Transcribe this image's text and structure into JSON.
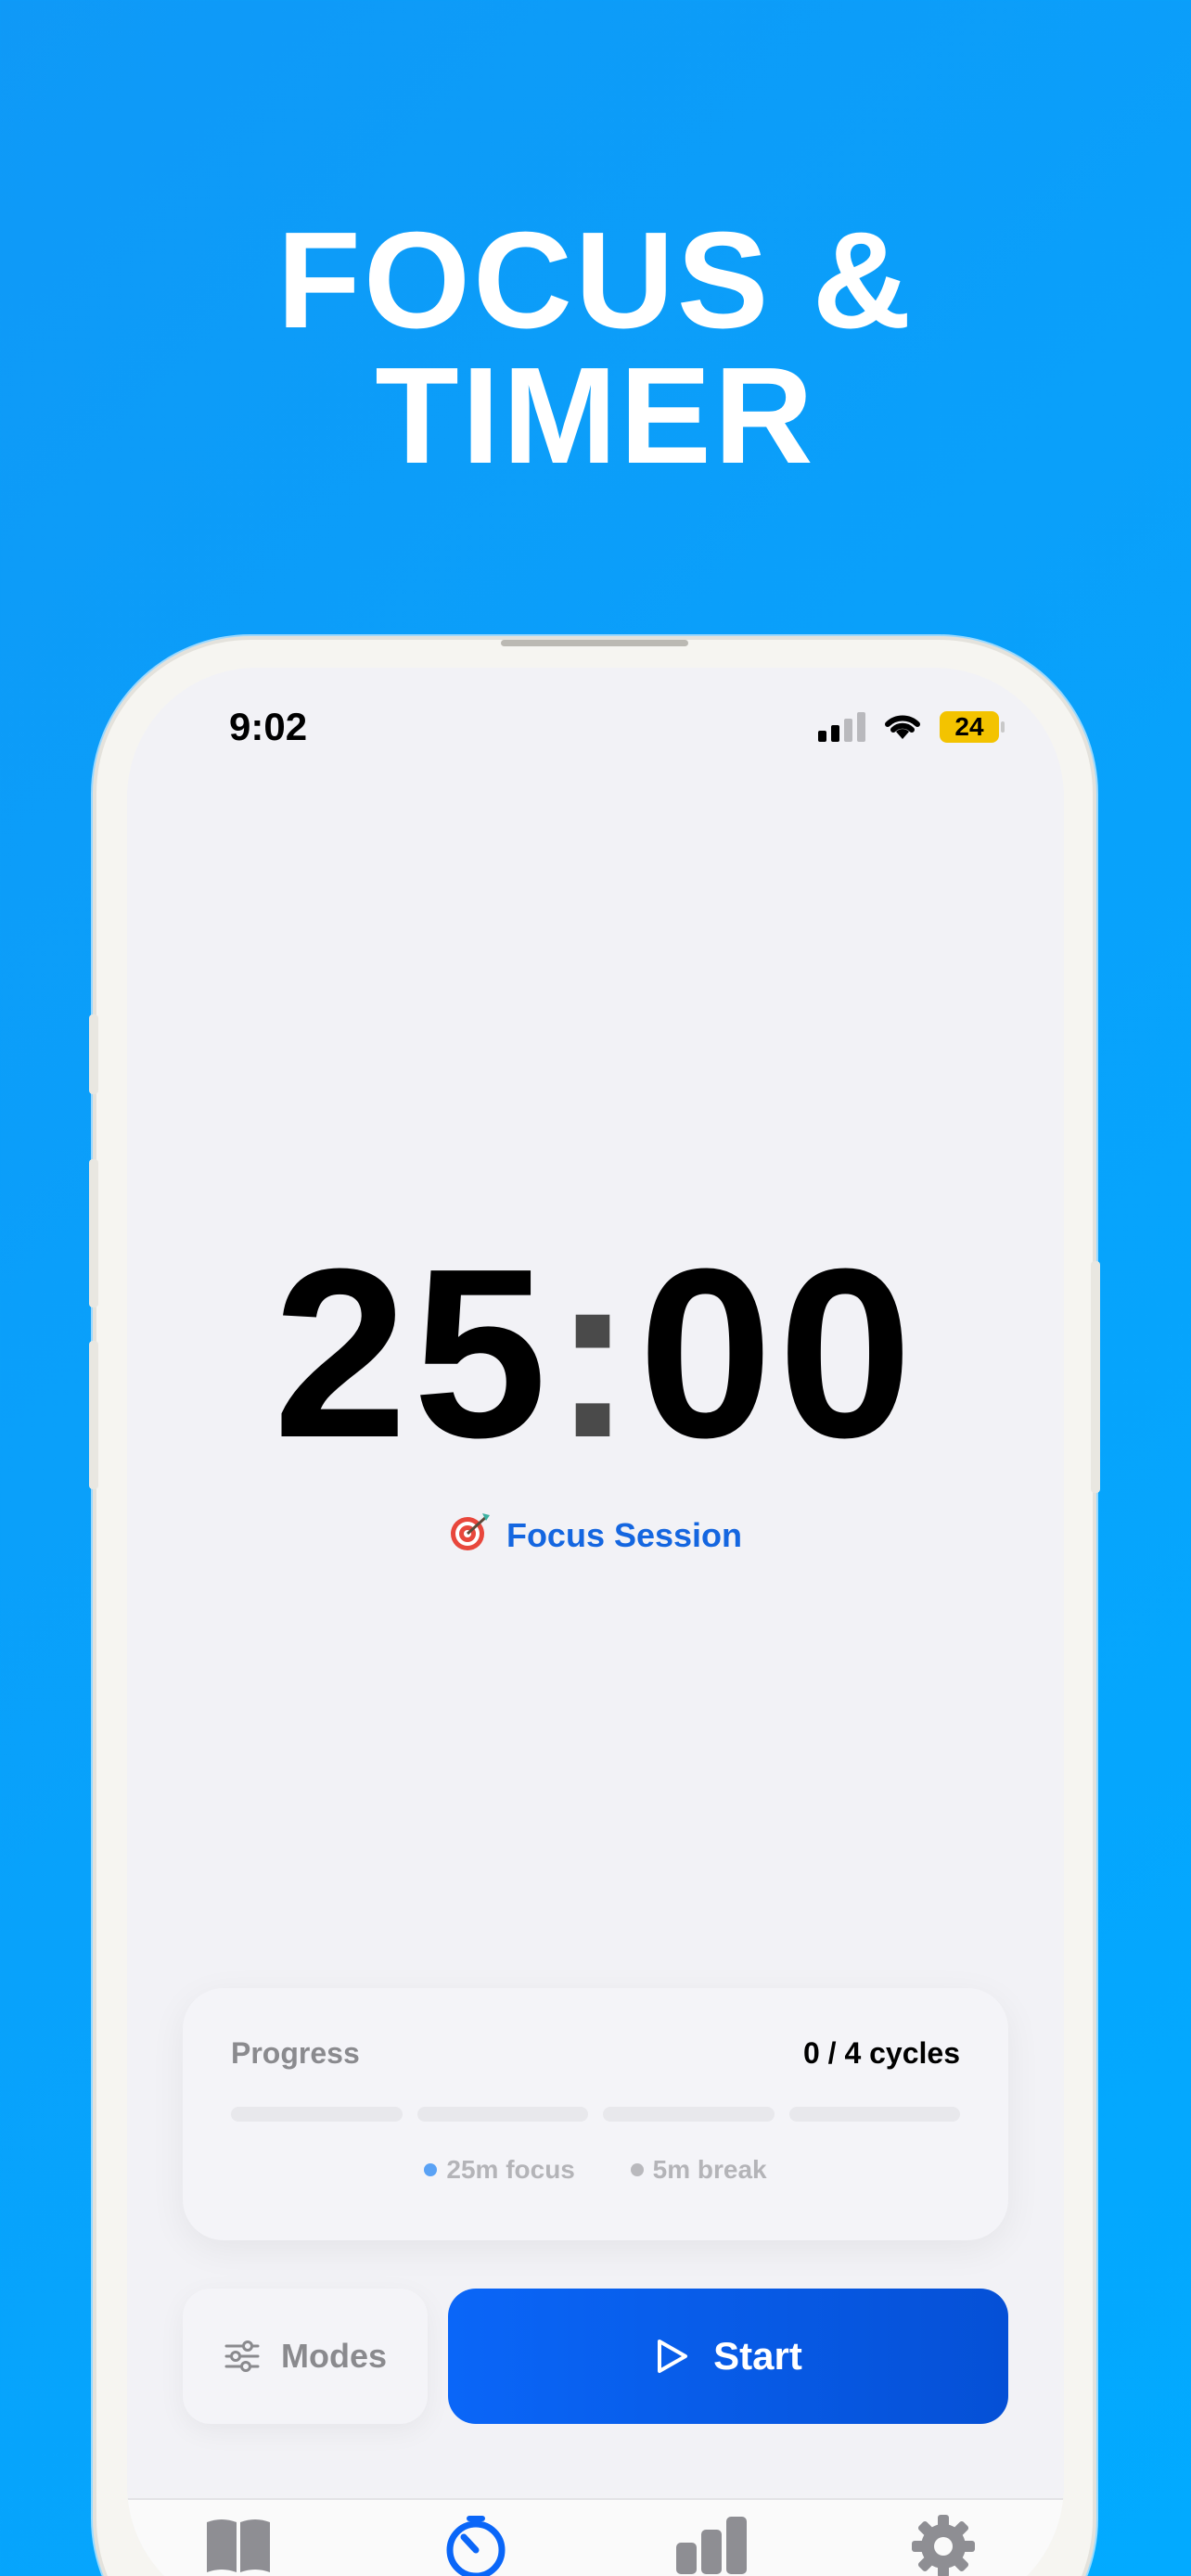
{
  "promo": {
    "headline_line1": "FOCUS &",
    "headline_line2": "TIMER"
  },
  "status_bar": {
    "time": "9:02",
    "battery": "24",
    "battery_color": "#f3c300"
  },
  "timer": {
    "minutes": "25",
    "separator": ":",
    "seconds": "00"
  },
  "session": {
    "icon": "target-icon",
    "label": "Focus Session",
    "color": "#1466e0"
  },
  "progress_card": {
    "label": "Progress",
    "cycles_text": "0 / 4 cycles",
    "cycles_completed": 0,
    "cycles_total": 4,
    "legend": [
      {
        "label": "25m focus",
        "color": "#5aa2f5"
      },
      {
        "label": "5m break",
        "color": "#b9b9bd"
      }
    ]
  },
  "controls": {
    "modes_label": "Modes",
    "modes_icon": "sliders-icon",
    "start_label": "Start",
    "start_icon": "play-icon",
    "accent": "#0a66f8"
  },
  "tab_bar": {
    "items": [
      {
        "icon": "book-icon",
        "active": false
      },
      {
        "icon": "timer-icon",
        "active": true
      },
      {
        "icon": "chart-icon",
        "active": false
      },
      {
        "icon": "gear-icon",
        "active": false
      }
    ]
  }
}
